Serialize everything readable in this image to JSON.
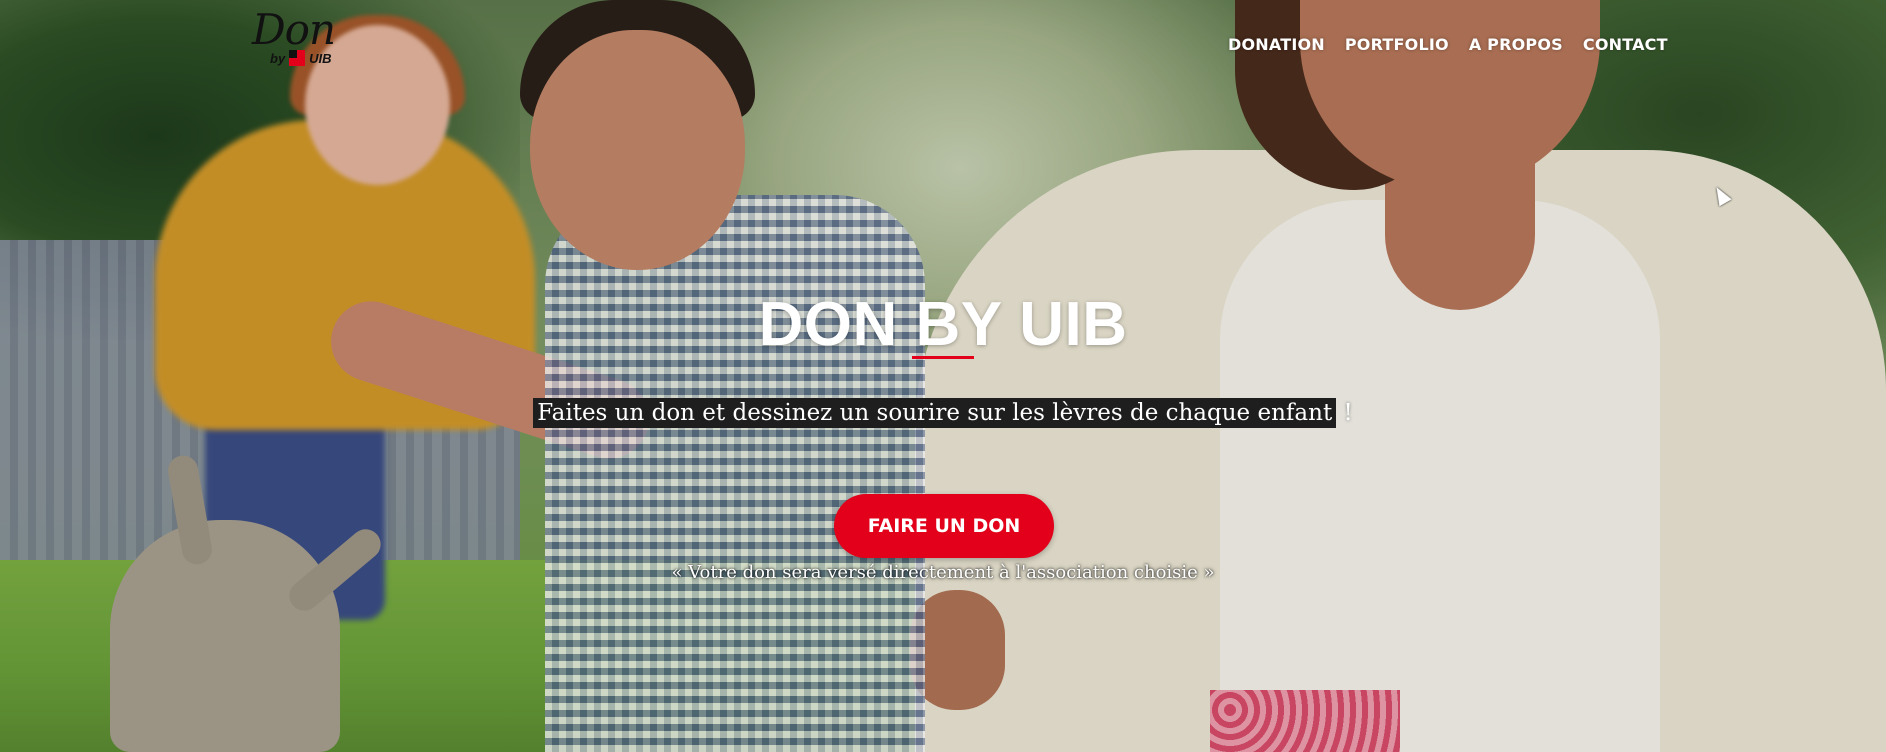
{
  "header": {
    "logo": {
      "word": "Don",
      "by": "by",
      "brand": "UIB"
    },
    "nav": [
      {
        "label": "DONATION"
      },
      {
        "label": "PORTFOLIO"
      },
      {
        "label": "A PROPOS"
      },
      {
        "label": "CONTACT"
      }
    ]
  },
  "hero": {
    "title": "DON BY UIB",
    "tagline_highlight": "Faites un don et dessinez un sourire sur les lèvres de chaque enfant",
    "tagline_end": " !",
    "cta_label": "FAIRE UN DON",
    "note": "« Votre don sera versé directement à l'association choisie »"
  },
  "colors": {
    "accent": "#e2001a",
    "nav_text": "#ffffff",
    "tagline_bg": "#1e1e1e"
  },
  "icons": {
    "cursor": "mouse-pointer-icon",
    "brand_mark": "uib-square-logo-icon"
  }
}
